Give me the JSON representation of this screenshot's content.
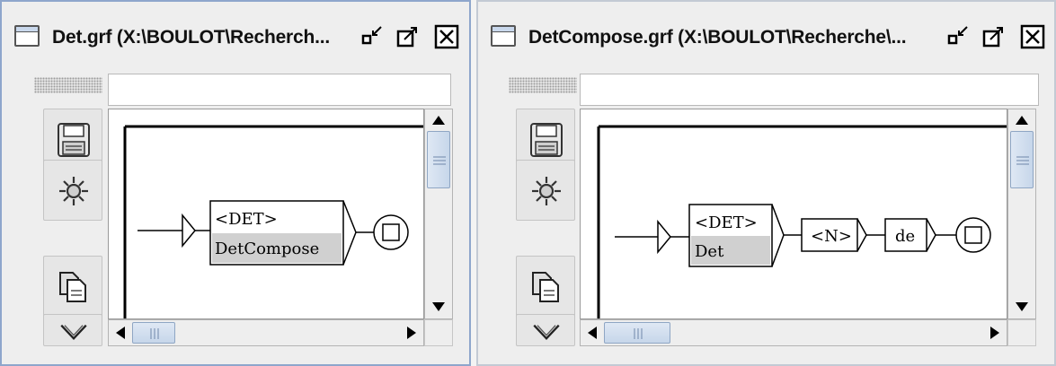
{
  "windows": [
    {
      "title": "Det.grf (X:\\BOULOT\\Recherch...",
      "toolbar_icons": [
        "save-icon",
        "compile-icon",
        "copy-icon",
        "cut-icon"
      ],
      "graph": {
        "boxes": [
          {
            "lines": [
              "<DET>",
              "DetCompose"
            ],
            "second_line_is_subgraph": true
          }
        ]
      }
    },
    {
      "title": "DetCompose.grf (X:\\BOULOT\\Recherche\\...",
      "toolbar_icons": [
        "save-icon",
        "compile-icon",
        "copy-icon",
        "cut-icon"
      ],
      "graph": {
        "boxes": [
          {
            "lines": [
              "<DET>",
              "Det"
            ],
            "second_line_is_subgraph": true
          },
          {
            "lines": [
              "<N>"
            ]
          },
          {
            "lines": [
              "de"
            ]
          }
        ]
      }
    }
  ],
  "colors": {
    "title_active_border": "#8ea6cc",
    "scroll_thumb": "#c6d6ea",
    "subgraph_highlight": "#d0d0d0"
  }
}
